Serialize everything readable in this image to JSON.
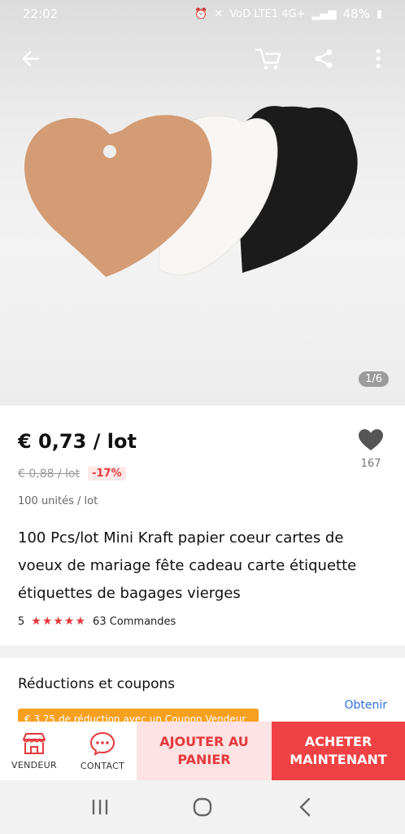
{
  "status": {
    "time": "22:02",
    "network": "VoD LTE1 4G+",
    "battery": "48%"
  },
  "gallery": {
    "counter": "1/6"
  },
  "product": {
    "price": "€ 0,73 / lot",
    "original_price": "€ 0,88 / lot",
    "discount": "-17%",
    "units": "100 unités / lot",
    "favorites": "167",
    "title": "100 Pcs/lot Mini Kraft papier coeur cartes de voeux de mariage fête cadeau carte étiquette étiquettes de bagages vierges",
    "rating": "5",
    "stars": "★★★★★",
    "orders": "63 Commandes"
  },
  "coupons": {
    "title": "Réductions et coupons",
    "obtain": "Obtenir",
    "banner": "€ 3,75 de réduction avec un Coupon Vendeur"
  },
  "actions": {
    "seller": "VENDEUR",
    "contact": "CONTACT",
    "add_to_cart": "AJOUTER AU PANIER",
    "buy_now": "ACHETER MAINTENANT"
  },
  "colors": {
    "accent": "#e4393c",
    "buy_bg": "#f04144",
    "add_bg": "#fde3e3",
    "coupon": "#f7a020",
    "link": "#2e6fd7"
  }
}
